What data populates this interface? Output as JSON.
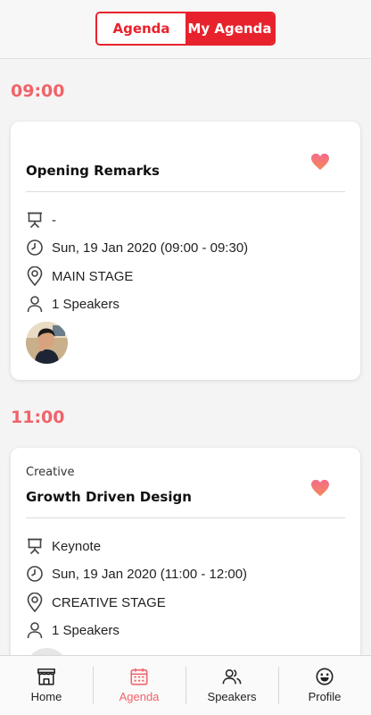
{
  "tabs": {
    "agenda": "Agenda",
    "my_agenda": "My Agenda"
  },
  "sessions": [
    {
      "time": "09:00",
      "category": "",
      "title": "Opening Remarks",
      "type": "-",
      "datetime": "Sun, 19 Jan 2020 (09:00 - 09:30)",
      "location": "MAIN STAGE",
      "speakers": "1 Speakers",
      "favorited": true
    },
    {
      "time": "11:00",
      "category": "Creative",
      "title": "Growth Driven Design",
      "type": "Keynote",
      "datetime": "Sun, 19 Jan 2020 (11:00 - 12:00)",
      "location": "CREATIVE STAGE",
      "speakers": "1 Speakers",
      "favorited": true
    }
  ],
  "nav": {
    "home": "Home",
    "agenda": "Agenda",
    "speakers": "Speakers",
    "profile": "Profile"
  },
  "colors": {
    "accent": "#e8222c",
    "time": "#f0636a",
    "heart": "#ef5f6b",
    "nav_active": "#f0636a"
  },
  "icons": [
    "presentation-icon",
    "clock-icon",
    "location-pin-icon",
    "person-icon",
    "heart-icon",
    "store-icon",
    "calendar-icon",
    "people-icon",
    "smiley-icon"
  ]
}
